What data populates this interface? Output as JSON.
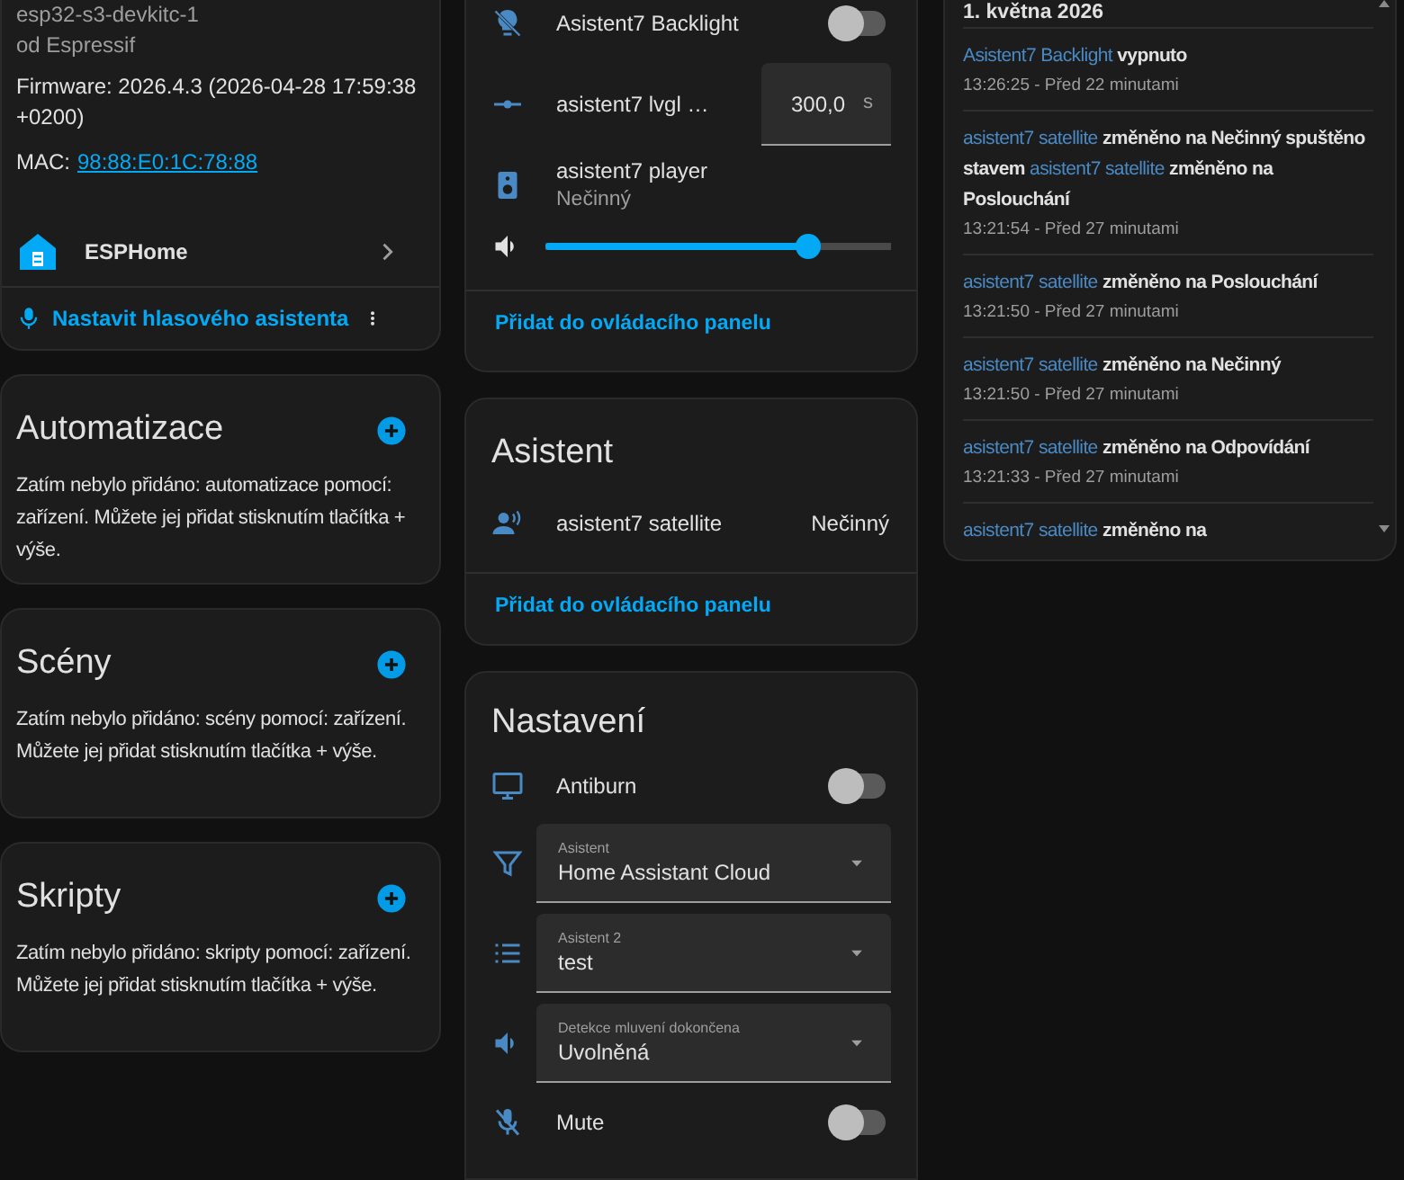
{
  "device_card": {
    "model": "esp32-s3-devkitc-1",
    "manufacturer": "od Espressif",
    "firmware": "Firmware: 2026.4.3 (2026-04-28 17:59:38 +0200)",
    "mac_label": "MAC:",
    "mac": "98:88:E0:1C:78:88",
    "integration": "ESPHome",
    "voice_action": "Nastavit hlasového asistenta"
  },
  "empty_sections": [
    {
      "title": "Automatizace",
      "message": "Zatím nebylo přidáno: automatizace pomocí: zařízení. Můžete jej přidat stisknutím tlačítka + výše."
    },
    {
      "title": "Scény",
      "message": "Zatím nebylo přidáno: scény pomocí: zařízení. Můžete jej přidat stisknutím tlačítka + výše."
    },
    {
      "title": "Skripty",
      "message": "Zatím nebylo přidáno: skripty pomocí: zařízení. Můžete jej přidat stisknutím tlačítka + výše."
    }
  ],
  "controls_card": {
    "rows": [
      {
        "kind": "toggle",
        "name": "Asistent7 Backlight",
        "on": false
      },
      {
        "kind": "number",
        "name": "asistent7 lvgl …",
        "value": "300,0",
        "unit": "s"
      },
      {
        "kind": "media",
        "name": "asistent7 player",
        "state": "Nečinný",
        "level": 0.76
      }
    ],
    "action": "Přidat do ovládacího panelu"
  },
  "assistant_card": {
    "title": "Asistent",
    "rows": [
      {
        "name": "asistent7 satellite",
        "state": "Nečinný"
      }
    ],
    "action": "Přidat do ovládacího panelu"
  },
  "settings_card": {
    "title": "Nastavení",
    "rows": [
      {
        "kind": "toggle",
        "name": "Antiburn",
        "on": false
      },
      {
        "kind": "select",
        "label": "Asistent",
        "value": "Home Assistant Cloud"
      },
      {
        "kind": "select",
        "label": "Asistent 2",
        "value": "test"
      },
      {
        "kind": "select",
        "label": "Detekce mluvení dokončena",
        "value": "Uvolněná"
      },
      {
        "kind": "toggle",
        "name": "Mute",
        "on": false
      }
    ]
  },
  "logbook": {
    "date": "1. května 2026",
    "entries": [
      {
        "parts": [
          {
            "kind": "entity",
            "text": "Asistent7 Backlight"
          },
          {
            "kind": "text",
            "text": "vypnuto"
          }
        ],
        "time": "13:26:25 - Před 22 minutami"
      },
      {
        "parts": [
          {
            "kind": "entity",
            "text": "asistent7 satellite"
          },
          {
            "kind": "text",
            "text": "změněno na Nečinný spuštěno stavem"
          },
          {
            "kind": "entity",
            "text": "asistent7 satellite"
          },
          {
            "kind": "text",
            "text": "změněno na Poslouchání"
          }
        ],
        "time": "13:21:54 - Před 27 minutami"
      },
      {
        "parts": [
          {
            "kind": "entity",
            "text": "asistent7 satellite"
          },
          {
            "kind": "text",
            "text": "změněno na Poslouchání"
          }
        ],
        "time": "13:21:50 - Před 27 minutami"
      },
      {
        "parts": [
          {
            "kind": "entity",
            "text": "asistent7 satellite"
          },
          {
            "kind": "text",
            "text": "změněno na Nečinný"
          }
        ],
        "time": "13:21:50 - Před 27 minutami"
      },
      {
        "parts": [
          {
            "kind": "entity",
            "text": "asistent7 satellite"
          },
          {
            "kind": "text",
            "text": "změněno na Odpovídání"
          }
        ],
        "time": "13:21:33 - Před 27 minutami"
      },
      {
        "parts": [
          {
            "kind": "entity",
            "text": "asistent7 satellite"
          },
          {
            "kind": "text",
            "text": "změněno na"
          }
        ]
      }
    ]
  }
}
